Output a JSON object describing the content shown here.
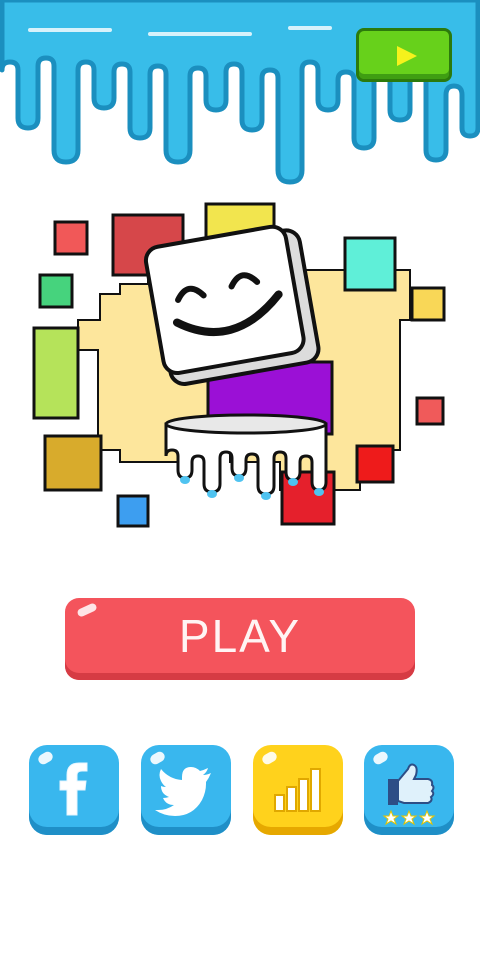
{
  "colors": {
    "drip_blue": "#38bde9",
    "drip_outline": "#1b8fbf",
    "video_green": "#67d11b",
    "play_red": "#f4545c",
    "social_blue": "#39b7ee",
    "leaderboard_yellow": "#ffd21c"
  },
  "header": {
    "video_button_icon": "play-triangle-icon"
  },
  "logo": {
    "character": "smiling-marshmallow-cube",
    "paint_bucket": "white-bucket-with-blue-drips"
  },
  "menu": {
    "play_label": "PLAY"
  },
  "social": [
    {
      "name": "facebook",
      "icon": "facebook-icon"
    },
    {
      "name": "twitter",
      "icon": "twitter-bird-icon"
    },
    {
      "name": "leaderboard",
      "icon": "bar-chart-icon"
    },
    {
      "name": "rate",
      "icon": "thumbs-up-stars-icon"
    }
  ]
}
